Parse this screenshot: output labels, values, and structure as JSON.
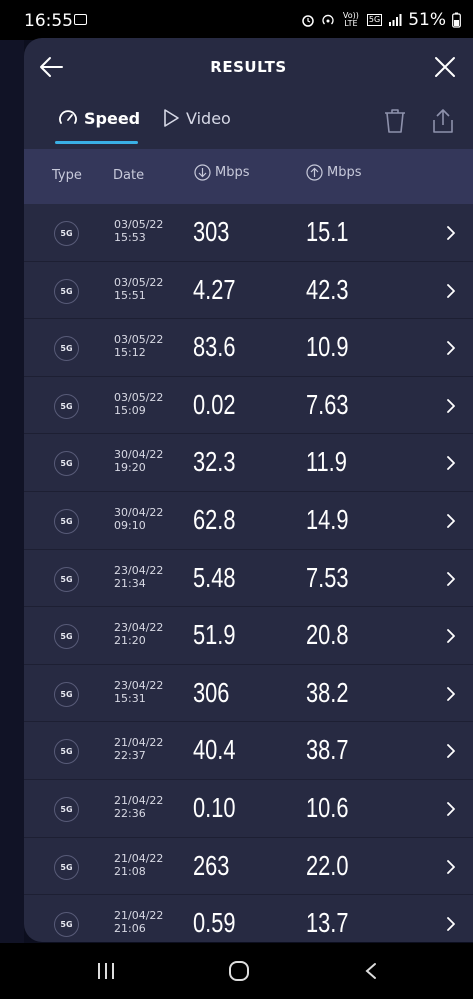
{
  "status": {
    "time": "16:55",
    "battery": "51%",
    "net_5g": "5G",
    "volte": "Vo)) LTE"
  },
  "header": {
    "title": "RESULTS"
  },
  "tabs": [
    {
      "label": "Speed",
      "active": true
    },
    {
      "label": "Video",
      "active": false
    }
  ],
  "columns": {
    "type": "Type",
    "date": "Date",
    "download": "Mbps",
    "upload": "Mbps"
  },
  "rows": [
    {
      "type": "5G",
      "date": "03/05/22",
      "time": "15:53",
      "down": "303",
      "up": "15.1"
    },
    {
      "type": "5G",
      "date": "03/05/22",
      "time": "15:51",
      "down": "4.27",
      "up": "42.3"
    },
    {
      "type": "5G",
      "date": "03/05/22",
      "time": "15:12",
      "down": "83.6",
      "up": "10.9"
    },
    {
      "type": "5G",
      "date": "03/05/22",
      "time": "15:09",
      "down": "0.02",
      "up": "7.63"
    },
    {
      "type": "5G",
      "date": "30/04/22",
      "time": "19:20",
      "down": "32.3",
      "up": "11.9"
    },
    {
      "type": "5G",
      "date": "30/04/22",
      "time": "09:10",
      "down": "62.8",
      "up": "14.9"
    },
    {
      "type": "5G",
      "date": "23/04/22",
      "time": "21:34",
      "down": "5.48",
      "up": "7.53"
    },
    {
      "type": "5G",
      "date": "23/04/22",
      "time": "21:20",
      "down": "51.9",
      "up": "20.8"
    },
    {
      "type": "5G",
      "date": "23/04/22",
      "time": "15:31",
      "down": "306",
      "up": "38.2"
    },
    {
      "type": "5G",
      "date": "21/04/22",
      "time": "22:37",
      "down": "40.4",
      "up": "38.7"
    },
    {
      "type": "5G",
      "date": "21/04/22",
      "time": "22:36",
      "down": "0.10",
      "up": "10.6"
    },
    {
      "type": "5G",
      "date": "21/04/22",
      "time": "21:08",
      "down": "263",
      "up": "22.0"
    },
    {
      "type": "5G",
      "date": "21/04/22",
      "time": "21:06",
      "down": "0.59",
      "up": "13.7"
    }
  ],
  "colors": {
    "modal_bg": "#272a42",
    "header_row_bg": "#34375a",
    "accent": "#3ab0e6",
    "page_bg": "#0c0e1e"
  },
  "icons": [
    "back-arrow-icon",
    "close-icon",
    "speed-gauge-icon",
    "play-icon",
    "trash-icon",
    "share-icon",
    "download-icon",
    "upload-icon",
    "chevron-right-icon"
  ]
}
